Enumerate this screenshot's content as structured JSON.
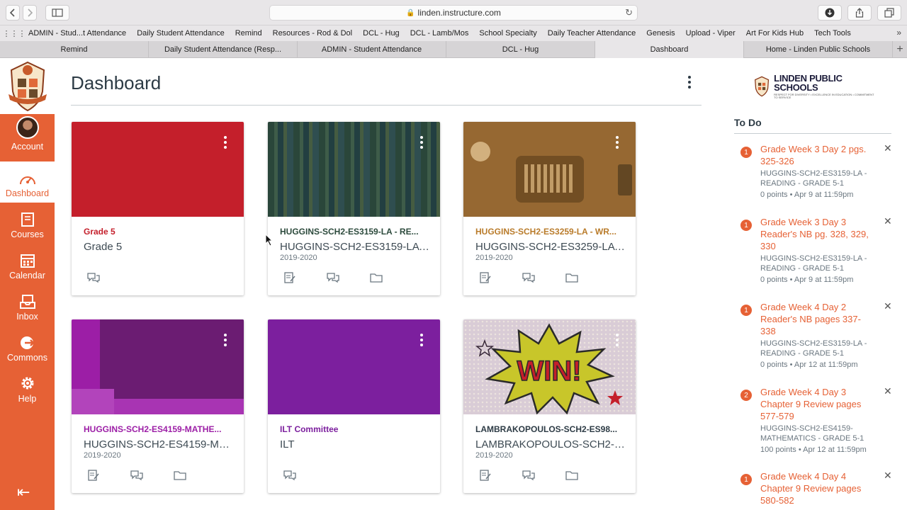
{
  "browser": {
    "url": "linden.instructure.com",
    "bookmarks": [
      "ADMIN - Stud...t Attendance",
      "Daily Student Attendance",
      "Remind",
      "Resources - Rod & Dol",
      "DCL - Hug",
      "DCL - Lamb/Mos",
      "School Specialty",
      "Daily Teacher Attendance",
      "Genesis",
      "Upload - Viper",
      "Art For Kids Hub",
      "Tech Tools"
    ],
    "tabs": [
      "Remind",
      "Daily Student Attendance (Resp...",
      "ADMIN - Student Attendance",
      "DCL - Hug",
      "Dashboard",
      "Home - Linden Public Schools"
    ],
    "active_tab": "Dashboard"
  },
  "nav": {
    "account": "Account",
    "dashboard": "Dashboard",
    "courses": "Courses",
    "calendar": "Calendar",
    "inbox": "Inbox",
    "commons": "Commons",
    "help": "Help"
  },
  "dashboard": {
    "title": "Dashboard",
    "cards": [
      {
        "title": "Grade 5",
        "subtitle": "Grade 5",
        "term": "",
        "color": "#c41f2b"
      },
      {
        "title": "HUGGINS-SCH2-ES3159-LA - RE...",
        "subtitle": "HUGGINS-SCH2-ES3159-LA -...",
        "term": "2019-2020",
        "color": "#2c4a3c"
      },
      {
        "title": "HUGGINS-SCH2-ES3259-LA - WR...",
        "subtitle": "HUGGINS-SCH2-ES3259-LA -...",
        "term": "2019-2020",
        "color": "#b97b2a"
      },
      {
        "title": "HUGGINS-SCH2-ES4159-MATHE...",
        "subtitle": "HUGGINS-SCH2-ES4159-MA...",
        "term": "2019-2020",
        "color": "#9c1ea6"
      },
      {
        "title": "ILT Committee",
        "subtitle": "ILT",
        "term": "",
        "color": "#7c1f9e"
      },
      {
        "title": "LAMBRAKOPOULOS-SCH2-ES98...",
        "subtitle": "LAMBRAKOPOULOS-SCH2-E...",
        "term": "2019-2020",
        "color": "#2d3b45"
      }
    ]
  },
  "brand": {
    "name": "LINDEN PUBLIC SCHOOLS",
    "tagline": "RESPECT FOR DIVERSITY • EXCELLENCE IN EDUCATION • COMMITMENT TO SERVICE"
  },
  "todo": {
    "heading": "To Do",
    "items": [
      {
        "count": "1",
        "title": "Grade Week 3 Day 2 pgs. 325-326",
        "course": "HUGGINS-SCH2-ES3159-LA - READING - GRADE 5-1",
        "meta": "0 points • Apr 9 at 11:59pm"
      },
      {
        "count": "1",
        "title": "Grade Week 3 Day 3 Reader's NB pg. 328, 329, 330",
        "course": "HUGGINS-SCH2-ES3159-LA - READING - GRADE 5-1",
        "meta": "0 points • Apr 9 at 11:59pm"
      },
      {
        "count": "1",
        "title": "Grade Week 4 Day 2 Reader's NB pages 337-338",
        "course": "HUGGINS-SCH2-ES3159-LA - READING - GRADE 5-1",
        "meta": "0 points • Apr 12 at 11:59pm"
      },
      {
        "count": "2",
        "title": "Grade Week 4 Day 3 Chapter 9 Review pages 577-579",
        "course": "HUGGINS-SCH2-ES4159-MATHEMATICS - GRADE 5-1",
        "meta": "100 points • Apr 12 at 11:59pm"
      },
      {
        "count": "1",
        "title": "Grade Week 4 Day 4 Chapter 9 Review pages 580-582",
        "course": "",
        "meta": ""
      }
    ]
  }
}
